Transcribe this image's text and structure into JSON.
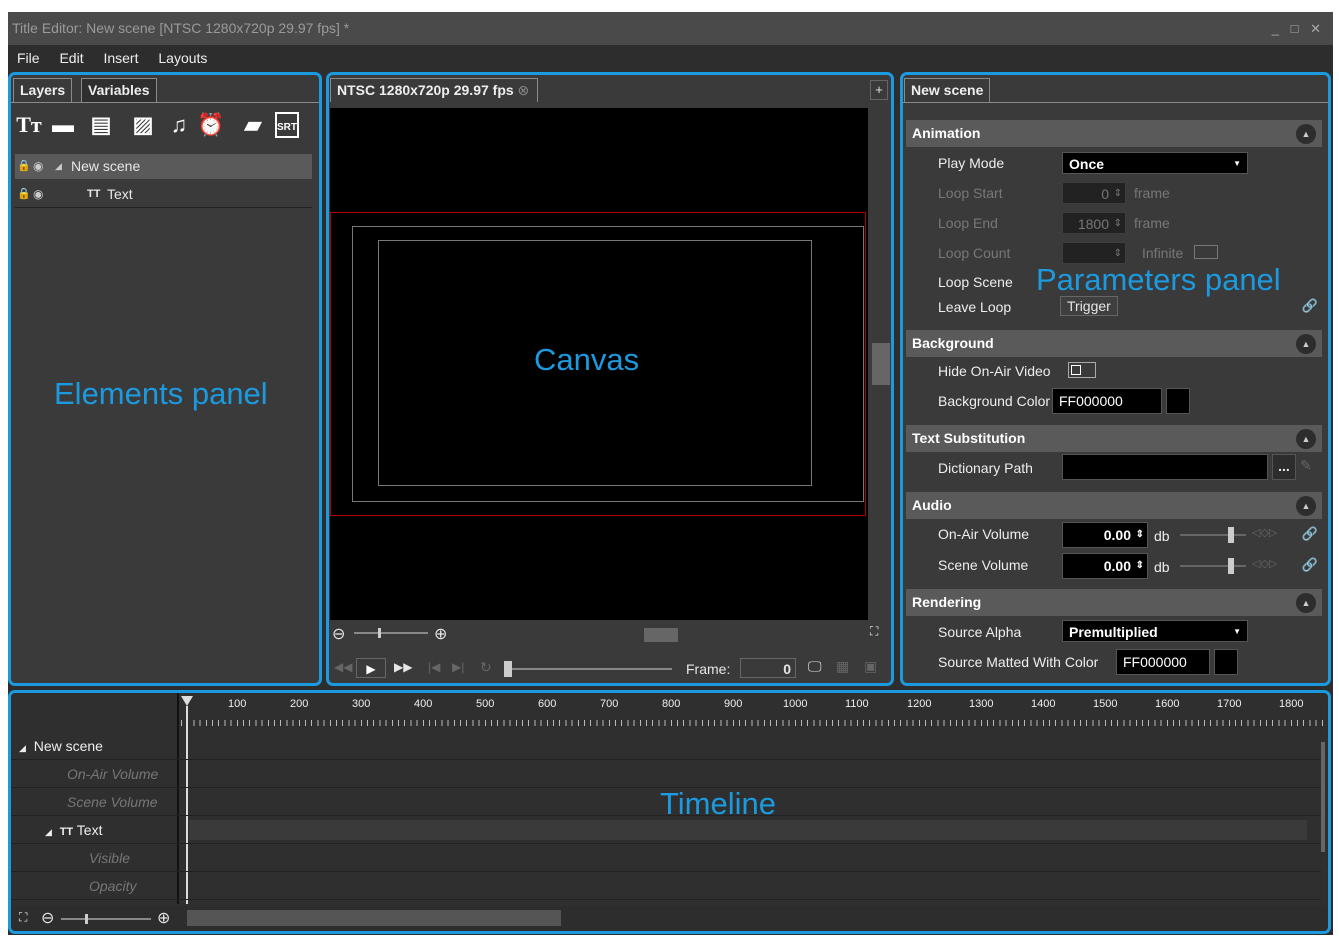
{
  "window": {
    "title": "Title Editor: New scene [NTSC 1280x720p 29.97 fps] *",
    "controls": "_ □ ✕"
  },
  "menu": {
    "file": "File",
    "edit": "Edit",
    "insert": "Insert",
    "layouts": "Layouts"
  },
  "elements": {
    "tab_layers": "Layers",
    "tab_variables": "Variables",
    "tree": {
      "scene": "New scene",
      "text_layer": "Text",
      "tt": "TT"
    },
    "overlay_label": "Elements panel"
  },
  "canvas": {
    "tab_label": "NTSC 1280x720p 29.97 fps",
    "add_tab": "+",
    "overlay_label": "Canvas",
    "frame_label": "Frame:",
    "frame_value": "0"
  },
  "params": {
    "tab": "New scene",
    "overlay_label": "Parameters panel",
    "animation": {
      "header": "Animation",
      "play_mode_label": "Play Mode",
      "play_mode_value": "Once",
      "loop_start_label": "Loop Start",
      "loop_start_value": "0",
      "loop_start_unit": "frame",
      "loop_end_label": "Loop End",
      "loop_end_value": "1800",
      "loop_end_unit": "frame",
      "loop_count_label": "Loop Count",
      "infinite_label": "Infinite",
      "loop_scene_label": "Loop Scene",
      "leave_loop_label": "Leave Loop",
      "trigger_label": "Trigger"
    },
    "background": {
      "header": "Background",
      "hide_label": "Hide On-Air Video",
      "color_label": "Background Color",
      "color_value": "FF000000"
    },
    "text_sub": {
      "header": "Text Substitution",
      "dict_label": "Dictionary Path",
      "browse": "..."
    },
    "audio": {
      "header": "Audio",
      "onair_label": "On-Air Volume",
      "onair_value": "0.00",
      "scene_label": "Scene Volume",
      "scene_value": "0.00",
      "unit": "db"
    },
    "rendering": {
      "header": "Rendering",
      "alpha_label": "Source Alpha",
      "alpha_value": "Premultiplied",
      "matted_label": "Source Matted With Color",
      "matted_value": "FF000000"
    }
  },
  "timeline": {
    "overlay_label": "Timeline",
    "ticks": [
      "100",
      "200",
      "300",
      "400",
      "500",
      "600",
      "700",
      "800",
      "900",
      "1000",
      "1100",
      "1200",
      "1300",
      "1400",
      "1500",
      "1600",
      "1700",
      "1800"
    ],
    "rows": {
      "scene": "New scene",
      "onair": "On-Air Volume",
      "scenevol": "Scene Volume",
      "text": "Text",
      "visible": "Visible",
      "opacity": "Opacity"
    }
  },
  "colors": {
    "accent": "#1c9ae0",
    "safe_area": "#b00000",
    "panel_bg": "#3a3a3a"
  }
}
